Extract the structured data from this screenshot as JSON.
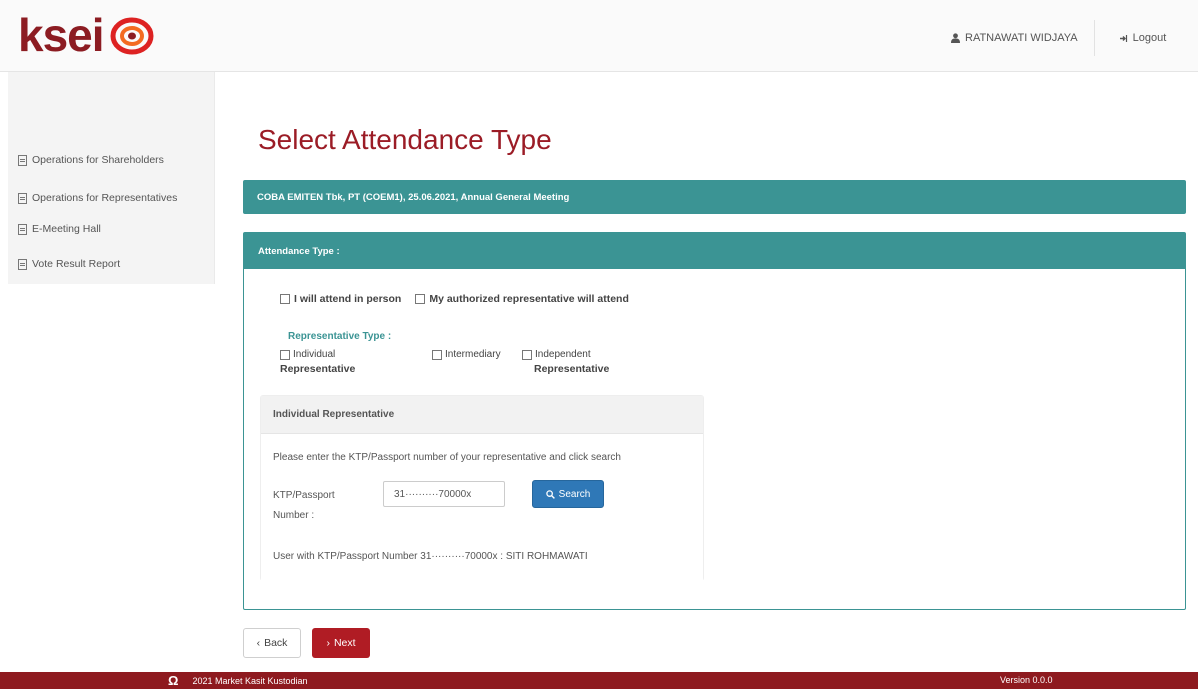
{
  "brand": {
    "logo_text": "ksei",
    "logo_tagline": "",
    "accent_color": "#9b1c26",
    "teal_color": "#3b9494"
  },
  "header": {
    "user_icon": "user-icon",
    "user_name": "RATNAWATI WIDJAYA",
    "logout_icon": "sign-out-icon",
    "logout_label": "Logout"
  },
  "sidebar": {
    "items": [
      {
        "label": "Operations for Shareholders",
        "icon": "document-icon"
      },
      {
        "label": "Operations for Representatives",
        "icon": "document-icon"
      },
      {
        "label": "E-Meeting Hall",
        "icon": "document-icon"
      },
      {
        "label": "Vote Result Report",
        "icon": "document-icon"
      }
    ]
  },
  "main": {
    "title": "Select Attendance Type",
    "meeting_info": "COBA EMITEN Tbk, PT (COEM1), 25.06.2021, Annual General Meeting",
    "attendance_header": "Attendance Type :",
    "options": {
      "in_person": "I will attend in person",
      "representative": "My authorized representative will attend"
    },
    "representative_type_label": "Representative Type :",
    "representative_types": [
      {
        "top": "Individual",
        "sub": "Representative"
      },
      {
        "top": "Intermediary",
        "sub": ""
      },
      {
        "top": "Independent",
        "sub": "Representative"
      }
    ],
    "individual": {
      "header": "Individual Representative",
      "instruction": "Please enter the KTP/Passport number of your representative and click search",
      "ktp_label": "KTP/Passport Number :",
      "ktp_value": "31··········70000x",
      "search_label": "Search",
      "search_icon": "search-icon",
      "result_text": "User with KTP/Passport Number 31··········70000x : SITI ROHMAWATI"
    }
  },
  "actions": {
    "back_label": "Back",
    "next_label": "Next"
  },
  "footer": {
    "copyright": "2021 Market Kasit Kustodian",
    "version": "Version 0.0.0"
  }
}
